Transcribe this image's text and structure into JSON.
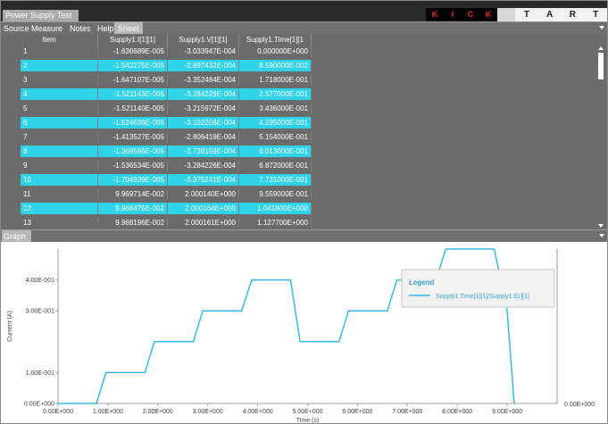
{
  "window": {
    "title": "Power Supply Test"
  },
  "brand": {
    "kick": [
      "K",
      "I",
      "C",
      "K"
    ],
    "start": [
      "S",
      "T",
      "A",
      "R",
      "T"
    ]
  },
  "menu": {
    "items": [
      "Source Measure",
      "Notes",
      "Help",
      "Sheet"
    ],
    "active": "Sheet"
  },
  "table": {
    "columns": [
      "Item",
      "Supply1.I[1][1]",
      "Supply1.V[1][1]",
      "Supply1.Time[1][1"
    ],
    "rows": [
      [
        "1",
        "-1.636689E-005",
        "-3.033947E-004",
        "0.000000E+000"
      ],
      [
        "2",
        "-1.542275E-005",
        "-2.897432E-004",
        "8.590000E-002"
      ],
      [
        "3",
        "-1.647107E-005",
        "-3.352484E-004",
        "1.718000E-001"
      ],
      [
        "4",
        "-1.521143E-005",
        "-3.284229E-004",
        "2.577000E-001"
      ],
      [
        "5",
        "-1.521140E-005",
        "-3.215972E-004",
        "3.436000E-001"
      ],
      [
        "6",
        "-1.524638E-005",
        "-3.102206E-004",
        "4.295000E-001"
      ],
      [
        "7",
        "-1.413527E-005",
        "-2.806419E-004",
        "5.154000E-001"
      ],
      [
        "8",
        "-1.369596E-005",
        "-2.738159E-004",
        "6.013000E-001"
      ],
      [
        "9",
        "-1.536534E-005",
        "-3.284226E-004",
        "6.872000E-001"
      ],
      [
        "10",
        "-1.704939E-005",
        "-3.375241E-004",
        "7.731000E-001"
      ],
      [
        "11",
        "9.969714E-002",
        "2.000140E+000",
        "9.559000E-001"
      ],
      [
        "12",
        "9.968475E-002",
        "2.000164E+000",
        "1.041800E+000"
      ],
      [
        "13",
        "9.968196E-002",
        "2.000161E+000",
        "1.127700E+000"
      ]
    ],
    "highlighted_rows": [
      2,
      4,
      6,
      8,
      10,
      12
    ]
  },
  "graph": {
    "tab_label": "Graph",
    "legend_title": "Legend",
    "legend_entry": "Supply1.Time[1][1]/Supply1.I[1][1]",
    "line_color": "#38b9e6",
    "highlight_color": "#2fd3ea"
  },
  "chart_data": {
    "type": "line",
    "xlabel": "Time (s)",
    "ylabel": "Current (A)",
    "xlim": [
      0,
      10
    ],
    "ylim": [
      0,
      0.5
    ],
    "x_ticks": [
      "0.00E+000",
      "1.00E+000",
      "2.00E+000",
      "3.00E+000",
      "4.00E+000",
      "5.00E+000",
      "6.00E+000",
      "7.00E+000",
      "8.00E+000",
      "9.00E+000"
    ],
    "y_ticks": [
      "0.00E+000",
      "1.00E-001",
      "3.00E-001",
      "4.00E-001"
    ],
    "y_tick_values": [
      0,
      0.1,
      0.3,
      0.4
    ],
    "right_axis_tick": "0.00E+000",
    "series": [
      {
        "name": "Supply1.Time[1][1]/Supply1.I[1][1]",
        "x": [
          0.0,
          0.77,
          0.96,
          1.74,
          1.93,
          2.71,
          2.9,
          3.68,
          3.88,
          4.66,
          4.85,
          5.63,
          5.82,
          6.6,
          6.79,
          7.57,
          7.77,
          8.55,
          8.74,
          9.0,
          9.14
        ],
        "y": [
          0.0,
          0.0,
          0.1,
          0.1,
          0.2,
          0.2,
          0.3,
          0.3,
          0.4,
          0.4,
          0.2,
          0.2,
          0.3,
          0.3,
          0.4,
          0.4,
          0.5,
          0.5,
          0.5,
          0.3,
          0.0
        ]
      }
    ]
  }
}
